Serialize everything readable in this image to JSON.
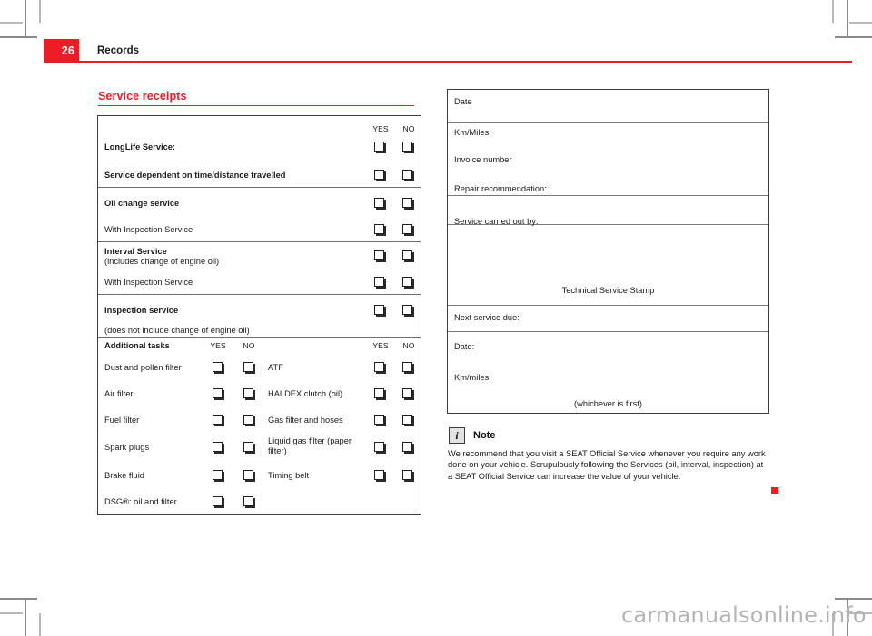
{
  "header": {
    "page_number": "26",
    "chapter_title": "Records",
    "accent_color": "#ee1c25"
  },
  "section": {
    "heading": "Service receipts"
  },
  "left_table": {
    "col_yes": "YES",
    "col_no": "NO",
    "rows": [
      {
        "label": "LongLife Service:",
        "bold": true
      },
      {
        "label": "Service dependent on time/distance travelled",
        "bold": true
      },
      {
        "label": "Oil change service",
        "bold": true
      },
      {
        "label": "With Inspection Service",
        "bold": false
      },
      {
        "label": "Interval Service",
        "sub": "(includes change of engine oil)",
        "bold": true
      },
      {
        "label": "With Inspection Service",
        "bold": false
      },
      {
        "label": "Inspection service",
        "sub": "(does not include change of engine oil)",
        "bold": true
      }
    ],
    "additional": {
      "title": "Additional tasks",
      "col_yes_left": "YES",
      "col_no_left": "NO",
      "col_yes_right": "YES",
      "col_no_right": "NO",
      "left_items": [
        "Dust and pollen filter",
        "Air filter",
        "Fuel filter",
        "Spark plugs",
        "Brake fluid",
        "DSG®: oil and filter"
      ],
      "right_items": [
        "ATF",
        "HALDEX clutch (oil)",
        "Gas filter and hoses",
        "Liquid gas filter (paper filter)",
        "Timing belt"
      ]
    }
  },
  "right_table": {
    "date": "Date",
    "km_miles": "Km/Miles:",
    "invoice_number": "Invoice number",
    "repair_recommendation": "Repair recommendation:",
    "service_carried_out_by": "Service carried out by:",
    "technical_service_stamp": "Technical Service Stamp",
    "next_service_due": "Next service due:",
    "next_date": "Date:",
    "next_km_miles": "Km/miles:",
    "whichever_is_first": "(whichever is first)"
  },
  "note": {
    "icon": "info-icon",
    "title": "Note",
    "body": "We recommend that you visit a SEAT Official Service whenever you require any work done on your vehicle. Scrupulously following the Services (oil, interval, inspection) at a SEAT Official Service can increase the value of your vehicle."
  },
  "watermark": {
    "text": "carmanualsonline.info"
  }
}
